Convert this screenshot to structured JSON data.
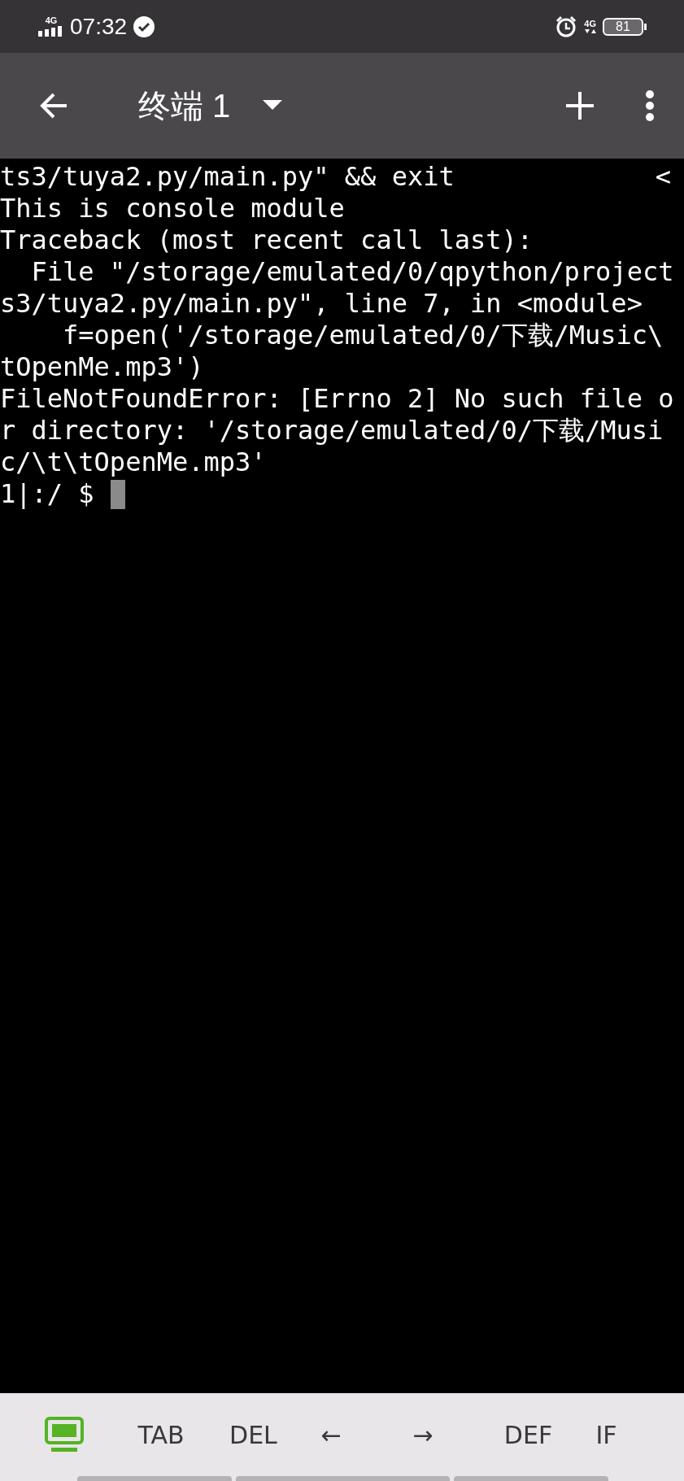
{
  "status_bar": {
    "time": "07:32",
    "network_left": "4G",
    "network_right": "4G",
    "battery": "81"
  },
  "toolbar": {
    "title": "终端 1"
  },
  "terminal": {
    "lines": [
      {
        "text": "ts3/tuya2.py/main.py\" && exit",
        "trailing": "<"
      },
      {
        "text": "This is console module"
      },
      {
        "text": "Traceback (most recent call last):"
      },
      {
        "text": "  File \"/storage/emulated/0/qpython/project"
      },
      {
        "text": "s3/tuya2.py/main.py\", line 7, in <module>"
      },
      {
        "text": "    f=open('/storage/emulated/0/下载/Music\\"
      },
      {
        "text": "tOpenMe.mp3')"
      },
      {
        "text": "FileNotFoundError: [Errno 2] No such file o"
      },
      {
        "text": "r directory: '/storage/emulated/0/下载/Musi"
      },
      {
        "text": "c/\\t\\tOpenMe.mp3'"
      }
    ],
    "prompt": "1|:/ $"
  },
  "keys": [
    {
      "kind": "icon"
    },
    {
      "kind": "text",
      "label": "TAB"
    },
    {
      "kind": "text",
      "label": "DEL"
    },
    {
      "kind": "text",
      "label": "←"
    },
    {
      "kind": "text",
      "label": "→"
    },
    {
      "kind": "text",
      "label": "DEF"
    },
    {
      "kind": "text",
      "label": "IF"
    }
  ]
}
